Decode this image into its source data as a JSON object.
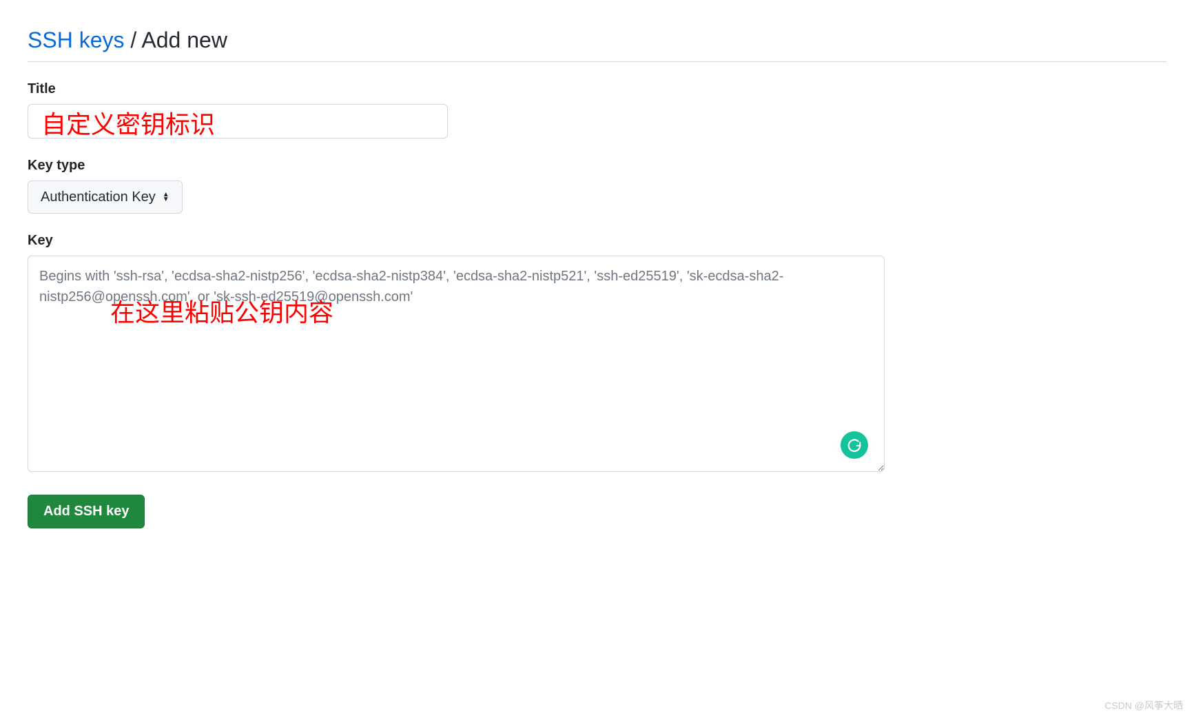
{
  "breadcrumb": {
    "link_text": "SSH keys",
    "separator": "/",
    "current": "Add new"
  },
  "form": {
    "title": {
      "label": "Title",
      "value": ""
    },
    "key_type": {
      "label": "Key type",
      "selected": "Authentication Key"
    },
    "key": {
      "label": "Key",
      "value": "",
      "placeholder": "Begins with 'ssh-rsa', 'ecdsa-sha2-nistp256', 'ecdsa-sha2-nistp384', 'ecdsa-sha2-nistp521', 'ssh-ed25519', 'sk-ecdsa-sha2-nistp256@openssh.com', or 'sk-ssh-ed25519@openssh.com'"
    },
    "submit_label": "Add SSH key"
  },
  "annotations": {
    "title_note": "自定义密钥标识",
    "key_note": "在这里粘贴公钥内容"
  },
  "icons": {
    "grammarly": "G"
  },
  "watermark": "CSDN @风筝大晒"
}
